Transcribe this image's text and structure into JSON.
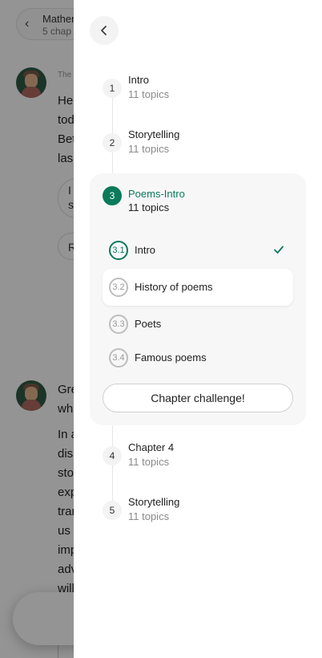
{
  "background": {
    "course_title": "Mather",
    "course_subtitle": "5 chap",
    "sender_name": "The",
    "message1_lines": [
      "He",
      "tod",
      "Bet",
      "las"
    ],
    "bubble1_lines": [
      "I",
      "s"
    ],
    "bubble2_text": "R",
    "message2_lines": [
      "Gre",
      "wh"
    ],
    "message3_lines": [
      "In a",
      "dis",
      "sto",
      "exp",
      "trar",
      "us",
      "imp",
      "adv",
      "will"
    ]
  },
  "drawer": {
    "close_icon": "chevron-left-icon",
    "chapters": [
      {
        "number": "1",
        "title": "Intro",
        "subtitle": "11 topics"
      },
      {
        "number": "2",
        "title": "Storytelling",
        "subtitle": "11 topics"
      },
      {
        "number": "3",
        "title": "Poems-Intro",
        "subtitle": "11 topics"
      },
      {
        "number": "4",
        "title": "Chapter 4",
        "subtitle": "11 topics"
      },
      {
        "number": "5",
        "title": "Storytelling",
        "subtitle": "11 topics"
      }
    ],
    "active_topics": [
      {
        "number": "3.1",
        "label": "Intro",
        "completed": true
      },
      {
        "number": "3.2",
        "label": "History of poems",
        "completed": false
      },
      {
        "number": "3.3",
        "label": "Poets",
        "completed": false
      },
      {
        "number": "3.4",
        "label": "Famous poems",
        "completed": false
      }
    ],
    "challenge_label": "Chapter challenge!",
    "accent_color": "#0b7a5a"
  }
}
